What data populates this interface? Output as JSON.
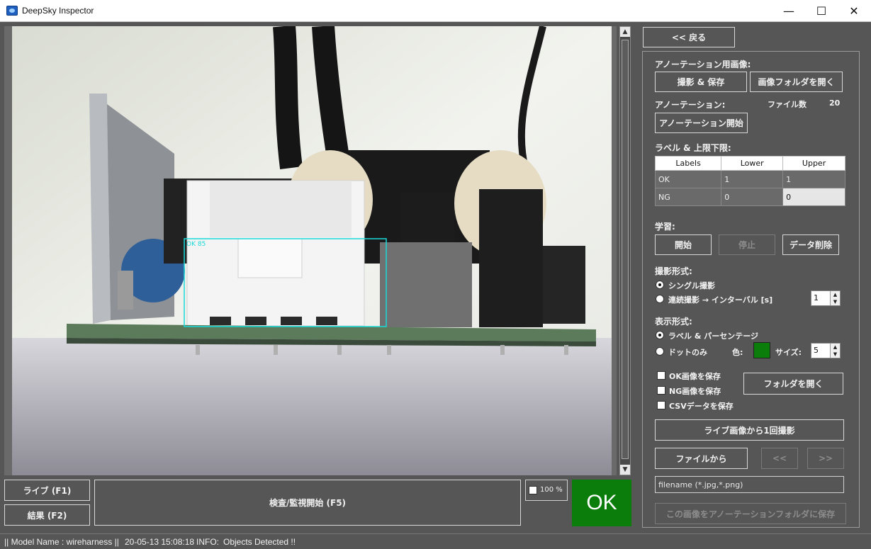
{
  "window": {
    "title": "DeepSky Inspector",
    "minimize": "—",
    "maximize": "☐",
    "close": "✕"
  },
  "viewer": {
    "detection_label": "OK 85"
  },
  "bottom": {
    "live_button": "ライブ (F1)",
    "result_button": "結果 (F2)",
    "inspect_button": "検査/監視開始 (F5)",
    "zoom_label": "100 %",
    "result_text": "OK",
    "result_color": "#0a7d0a"
  },
  "panel": {
    "back_button": "<< 戻る",
    "annotation_image_heading": "アノーテーション用画像:",
    "capture_save_button": "撮影 & 保存",
    "open_image_folder_button": "画像フォルダを開く",
    "annotation_heading": "アノーテーション:",
    "file_count_label": "ファイル数",
    "file_count_value": "20",
    "start_annotation_button": "アノーテーション開始",
    "label_limits_heading": "ラベル & 上限下限:",
    "table": {
      "headers": [
        "Labels",
        "Lower",
        "Upper"
      ],
      "rows": [
        [
          "OK",
          "1",
          "1"
        ],
        [
          "NG",
          "0",
          "0"
        ]
      ]
    },
    "learning_heading": "学習:",
    "learn_start_button": "開始",
    "learn_stop_button": "停止",
    "data_delete_button": "データ削除",
    "capture_mode_heading": "撮影形式:",
    "single_capture": "シングル撮影",
    "continuous_capture": "連続撮影 → インターバル [s]",
    "interval_value": "1",
    "display_mode_heading": "表示形式:",
    "label_percentage": "ラベル & パーセンテージ",
    "dot_only": "ドットのみ",
    "color_label": "色:",
    "dot_color": "#0a7d0a",
    "size_label": "サイズ:",
    "size_value": "5",
    "save_ok_images": "OK画像を保存",
    "save_ng_images": "NG画像を保存",
    "save_csv": "CSVデータを保存",
    "open_folder_button": "フォルダを開く",
    "live_capture_button": "ライブ画像から1回撮影",
    "from_file_button": "ファイルから",
    "prev_button": "<<",
    "next_button": ">>",
    "filename_value": "filename (*.jpg,*.png)",
    "save_to_annotation_button": "この画像をアノーテーションフォルダに保存"
  },
  "status": {
    "model": "|| Model Name : wireharness ||",
    "timestamp": "20-05-13 15:08:18",
    "info_label": "INFO:",
    "info_text": "Objects Detected !!"
  }
}
